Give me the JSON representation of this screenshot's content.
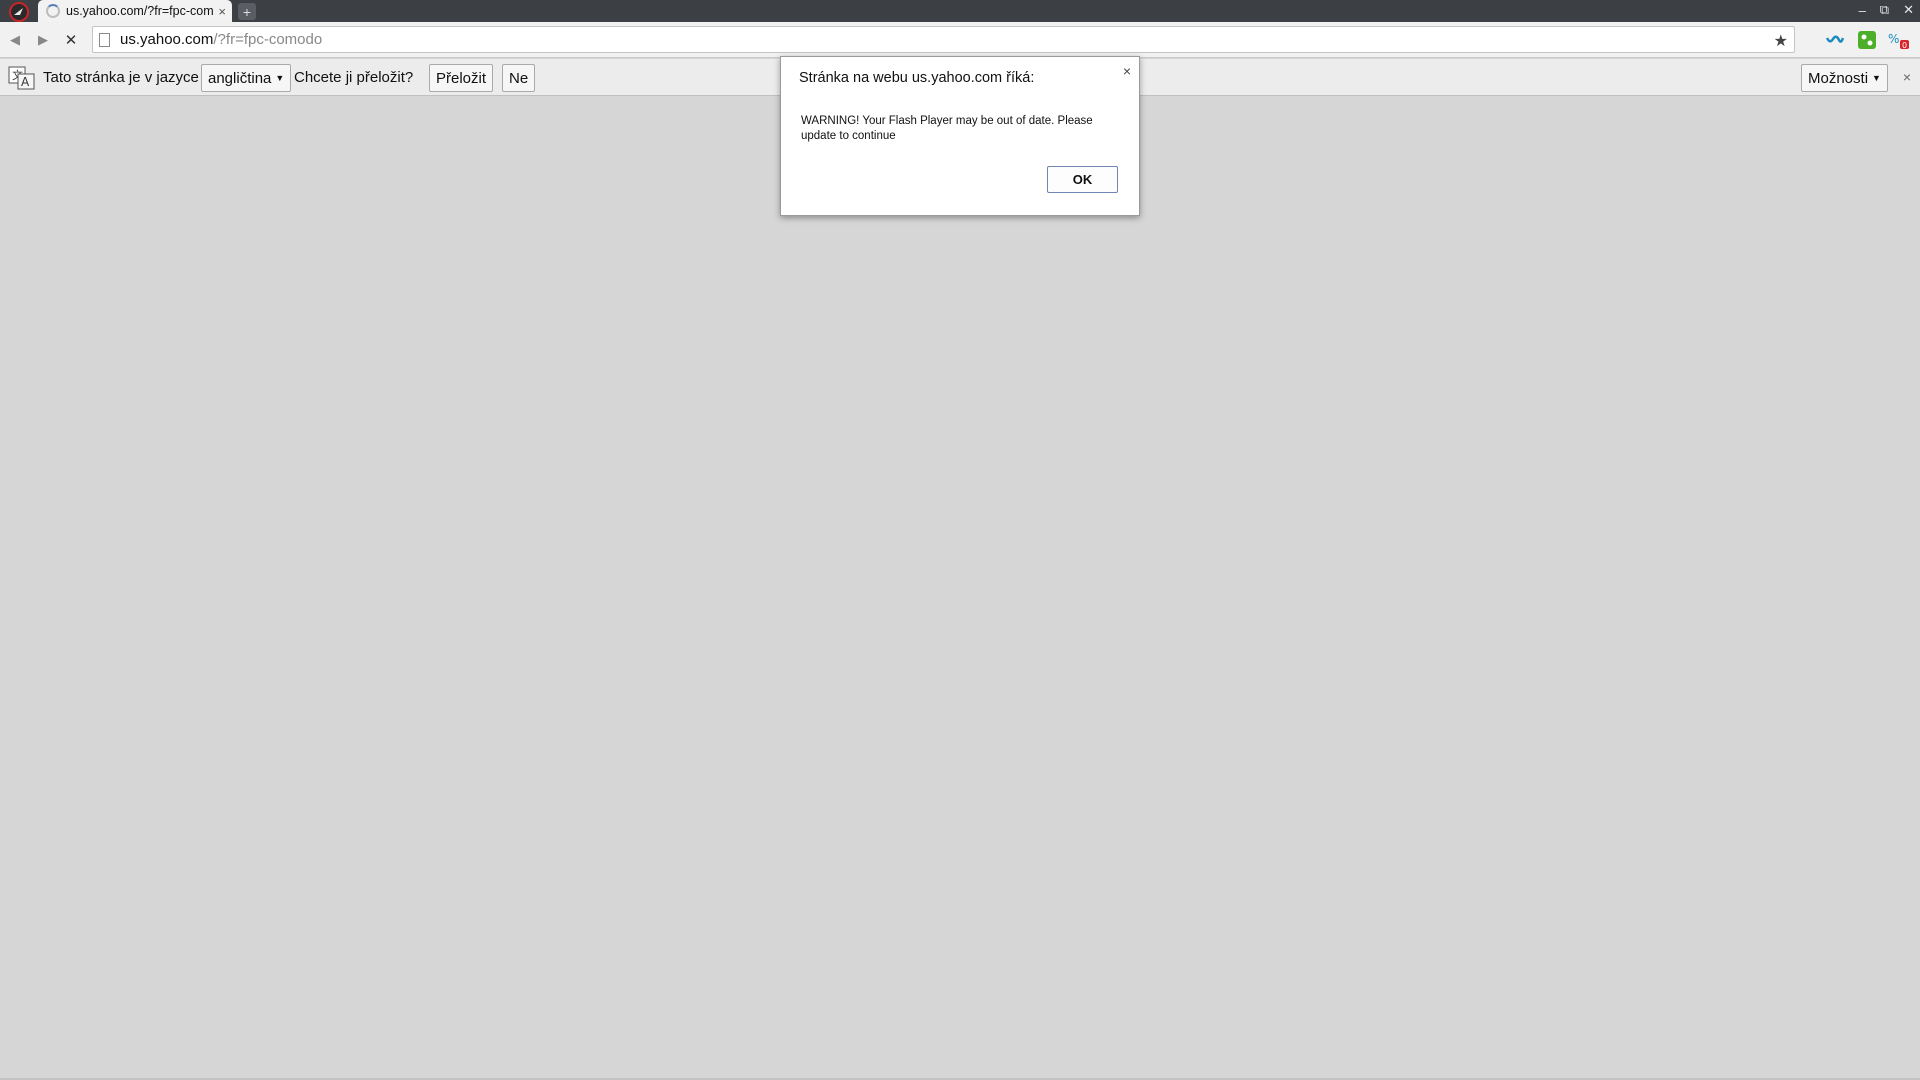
{
  "tab": {
    "title": "us.yahoo.com/?fr=fpc-com",
    "close_glyph": "×",
    "new_tab_glyph": "+"
  },
  "window_controls": {
    "minimize": "–",
    "restore": "⧉",
    "close": "✕"
  },
  "address_bar": {
    "url_host": "us.yahoo.com",
    "url_path": "/?fr=fpc-comodo"
  },
  "translate_bar": {
    "prefix": "Tato stránka je v jazyce",
    "language": "angličtina",
    "question": "Chcete ji přeložit?",
    "translate_button": "Přeložit",
    "no_button": "Ne",
    "options_button": "Možnosti",
    "close_glyph": "×"
  },
  "dialog": {
    "title": "Stránka na webu us.yahoo.com říká:",
    "message": "WARNING! Your Flash Player may be out of date. Please update to continue",
    "ok_button": "OK",
    "close_glyph": "×"
  },
  "icons": {
    "app_logo": "comodo-dragon-logo",
    "back": "back-arrow-icon",
    "forward": "forward-arrow-icon",
    "stop": "stop-icon",
    "bookmark": "star-icon",
    "translate": "translate-icon"
  },
  "colors": {
    "titlebar": "#3c3f44",
    "page_background": "#d6d6d6",
    "extension_green": "#4caf2a",
    "extension_teal": "#1a8ac0",
    "badge_red": "#d8242b"
  }
}
